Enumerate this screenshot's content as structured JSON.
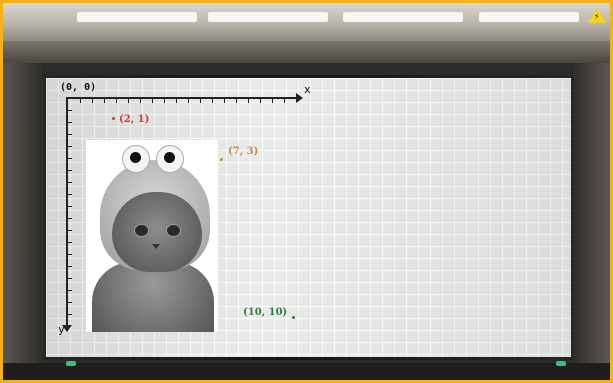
{
  "axes": {
    "origin_label": "(0, 0)",
    "x_label": "x",
    "y_label": "y"
  },
  "points": [
    {
      "label": "(2, 1)",
      "color": "#d33a2c"
    },
    {
      "label": "(7, 3)",
      "color": "#c98a3a"
    },
    {
      "label": "(10, 10)",
      "color": "#2f7d3a"
    }
  ],
  "colors": {
    "frame_border": "#f3b21c",
    "warning_sign": "#f7d21f",
    "indicator_led": "#34c27b"
  },
  "icons": {
    "warning": "warning-triangle-icon"
  }
}
